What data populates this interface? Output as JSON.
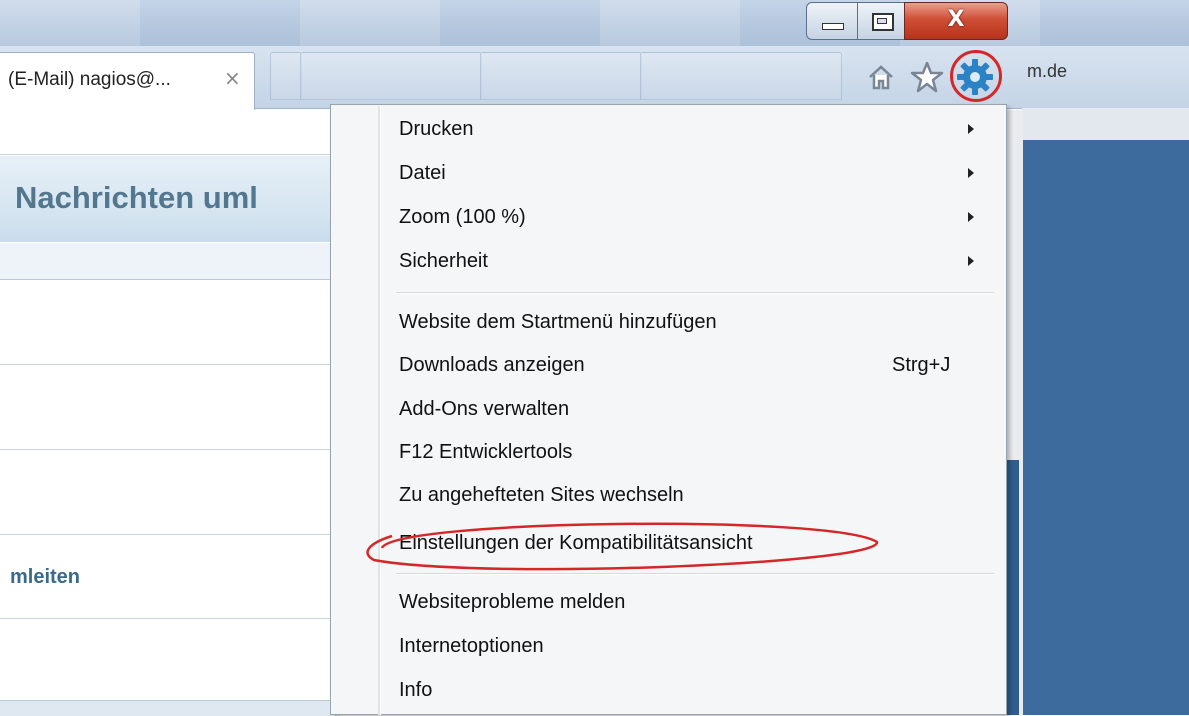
{
  "window": {
    "caption_buttons": {
      "minimize": "",
      "maximize": "",
      "close": "X"
    }
  },
  "tabs": {
    "active_title": "(E-Mail) nagios@...",
    "close_glyph": "×",
    "address_fragment": "m.de"
  },
  "toolbar": {
    "icons": [
      "home-icon",
      "star-icon",
      "gear-icon"
    ],
    "highlight_color": "#d62728"
  },
  "page": {
    "heading": "Nachrichten uml",
    "link": "mleiten"
  },
  "menu": {
    "group1": [
      {
        "label": "Drucken",
        "submenu": true
      },
      {
        "label": "Datei",
        "submenu": true
      },
      {
        "label": "Zoom (100 %)",
        "submenu": true
      },
      {
        "label": "Sicherheit",
        "submenu": true
      }
    ],
    "group2": [
      {
        "label": "Website dem Startmenü hinzufügen"
      },
      {
        "label": "Downloads anzeigen",
        "shortcut": "Strg+J"
      },
      {
        "label": "Add-Ons verwalten"
      },
      {
        "label": "F12 Entwicklertools"
      },
      {
        "label": "Zu angehefteten Sites wechseln"
      },
      {
        "label": "Einstellungen der Kompatibilitätsansicht",
        "highlighted": true
      }
    ],
    "group3": [
      {
        "label": "Websiteprobleme melden"
      },
      {
        "label": "Internetoptionen"
      },
      {
        "label": "Info"
      }
    ]
  }
}
